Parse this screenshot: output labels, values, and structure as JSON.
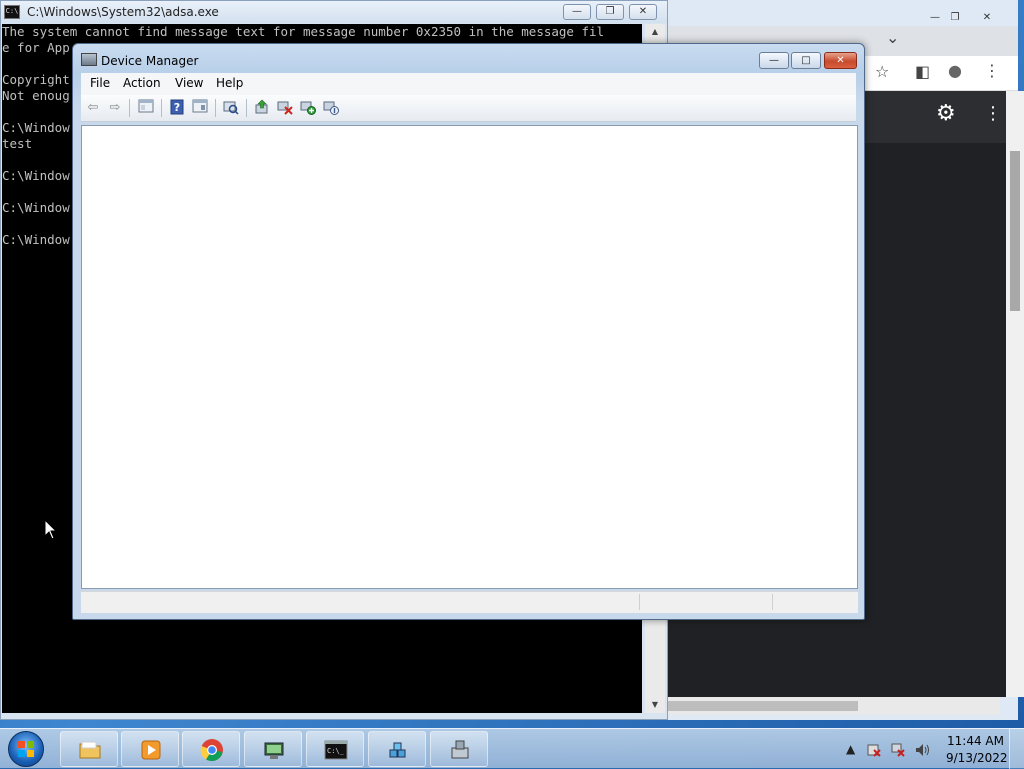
{
  "console": {
    "title": "C:\\Windows\\System32\\adsa.exe",
    "lines": [
      "The system cannot find message text for message number 0x2350 in the message fil",
      "e for App",
      "",
      "Copyright",
      "Not enoug",
      "",
      "C:\\Window",
      "test",
      "",
      "C:\\Window",
      "",
      "C:\\Window",
      "",
      "C:\\Window"
    ],
    "minimize": "—",
    "maximize": "❐",
    "close": "✕"
  },
  "browser": {
    "minimize": "—",
    "maximize": "❐",
    "close": "✕",
    "dropdown": "⌄",
    "star": "☆",
    "sidepanel": "◧",
    "profile": "●",
    "menu": "⋮",
    "settings": "⚙"
  },
  "device_manager": {
    "title": "Device Manager",
    "menu": [
      "File",
      "Action",
      "View",
      "Help"
    ],
    "minimize": "—",
    "maximize": "□",
    "close": "✕"
  },
  "taskbar": {
    "apps": [
      {
        "name": "windows-explorer"
      },
      {
        "name": "media-player"
      },
      {
        "name": "google-chrome"
      },
      {
        "name": "network-manager"
      },
      {
        "name": "command-prompt"
      },
      {
        "name": "registry-tool"
      },
      {
        "name": "device-manager"
      }
    ],
    "clock_time": "11:44 AM",
    "clock_date": "9/13/2022"
  },
  "colors": {
    "console_bg": "#000000",
    "console_text": "#c0c0c0",
    "dm_frame": "#b7cfe9",
    "close_red": "#c74b2d"
  }
}
